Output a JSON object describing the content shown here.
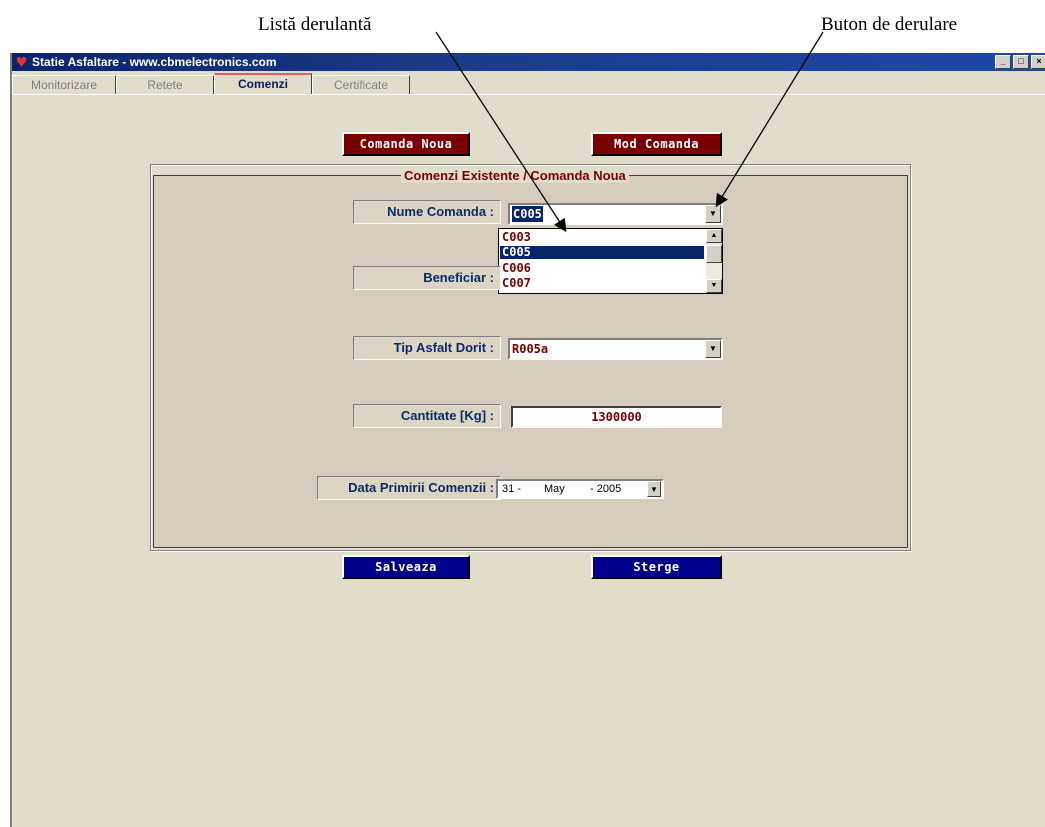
{
  "annotations": {
    "list_label": "Listă derulantă",
    "button_label": "Buton de derulare"
  },
  "window": {
    "title": "Statie Asfaltare - www.cbmelectronics.com",
    "controls": [
      "_",
      "□",
      "×"
    ]
  },
  "tabs": [
    {
      "label": "Monitorizare",
      "active": false
    },
    {
      "label": "Retete",
      "active": false
    },
    {
      "label": "Comenzi",
      "active": true
    },
    {
      "label": "Certificate",
      "active": false
    }
  ],
  "toolbar": {
    "new_order": "Comanda Noua",
    "mod_order": "Mod Comanda"
  },
  "group": {
    "legend": "Comenzi Existente / Comanda Noua"
  },
  "form": {
    "nume_label": "Nume Comanda :",
    "nume_value": "C005",
    "dropdown_items": [
      {
        "value": "C003",
        "selected": false
      },
      {
        "value": "C005",
        "selected": true
      },
      {
        "value": "C006",
        "selected": false
      },
      {
        "value": "C007",
        "selected": false
      }
    ],
    "beneficiar_label": "Beneficiar :",
    "tip_label": "Tip Asfalt Dorit :",
    "tip_value": "R005a",
    "cantitate_label": "Cantitate [Kg] :",
    "cantitate_value": "1300000",
    "data_label": "Data Primirii Comenzii :",
    "date": {
      "day": "31 -",
      "month": "May",
      "year": "- 2005"
    }
  },
  "actions": {
    "save": "Salveaza",
    "delete": "Sterge"
  },
  "colors": {
    "accent_red": "#7a0000",
    "accent_blue": "#00008a",
    "background": "#e2dccb"
  }
}
